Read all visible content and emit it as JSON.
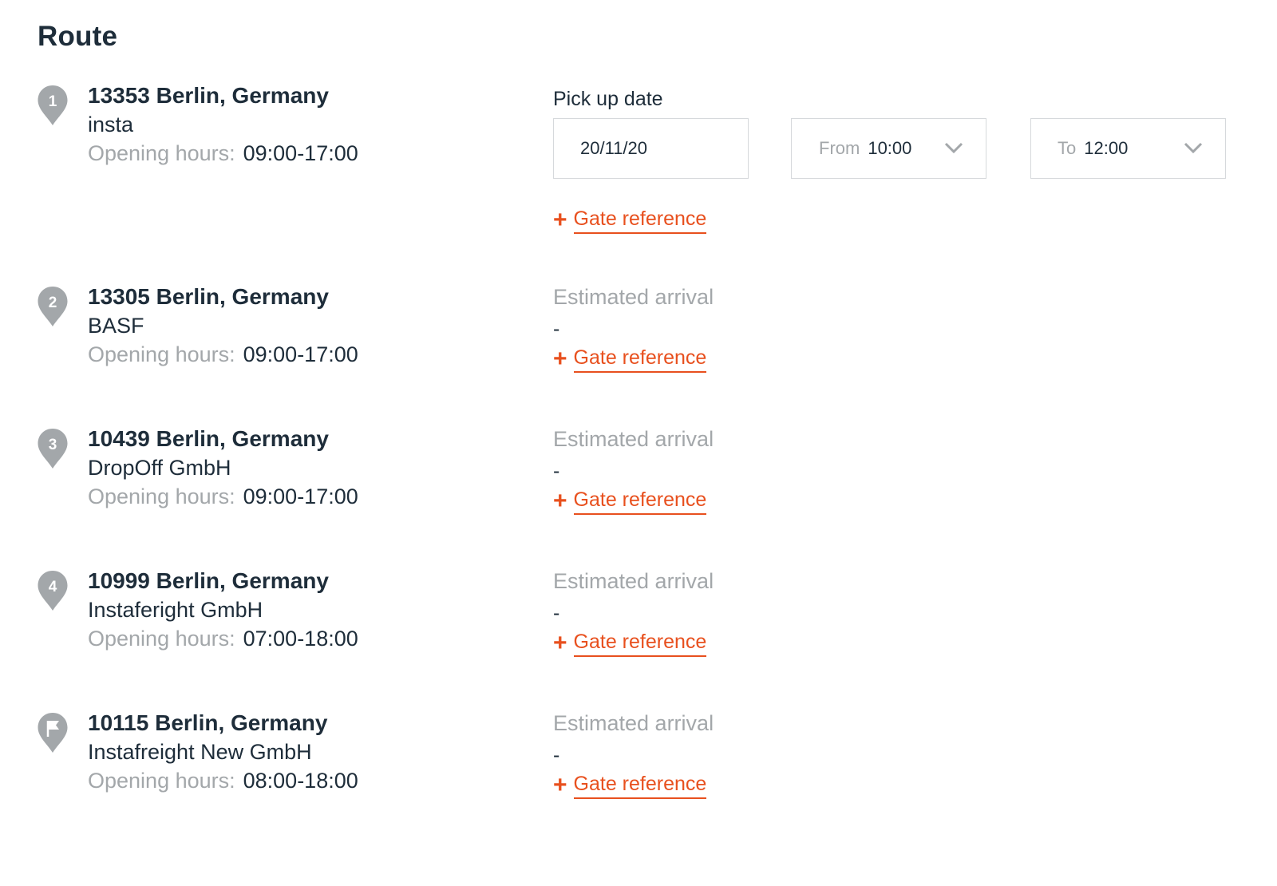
{
  "title": "Route",
  "pickup": {
    "label": "Pick up date",
    "date_value": "20/11/20",
    "from_label": "From",
    "from_value": "10:00",
    "to_label": "To",
    "to_value": "12:00"
  },
  "gate_reference_label": "Gate reference",
  "stops": [
    {
      "marker": "1",
      "marker_icon": "map-pin-icon",
      "address": "13353 Berlin, Germany",
      "company": "insta",
      "hours_label": "Opening hours:",
      "hours_value": "09:00-17:00"
    },
    {
      "marker": "2",
      "marker_icon": "map-pin-icon",
      "address": "13305 Berlin, Germany",
      "company": "BASF",
      "hours_label": "Opening hours:",
      "hours_value": "09:00-17:00",
      "eta_label": "Estimated arrival",
      "eta_value": "-"
    },
    {
      "marker": "3",
      "marker_icon": "map-pin-icon",
      "address": "10439 Berlin, Germany",
      "company": "DropOff GmbH",
      "hours_label": "Opening hours:",
      "hours_value": "09:00-17:00",
      "eta_label": "Estimated arrival",
      "eta_value": "-"
    },
    {
      "marker": "4",
      "marker_icon": "map-pin-icon",
      "address": "10999 Berlin, Germany",
      "company": "Instaferight GmbH",
      "hours_label": "Opening hours:",
      "hours_value": "07:00-18:00",
      "eta_label": "Estimated arrival",
      "eta_value": "-"
    },
    {
      "marker": "",
      "marker_icon": "flag-pin-icon",
      "address": "10115 Berlin, Germany",
      "company": "Instafreight New GmbH",
      "hours_label": "Opening hours:",
      "hours_value": "08:00-18:00",
      "eta_label": "Estimated arrival",
      "eta_value": "-"
    }
  ],
  "colors": {
    "text": "#1e2d3a",
    "muted": "#a3a7aa",
    "accent": "#e8501e",
    "pin": "#a3a7aa",
    "border": "#d6d9dc"
  }
}
